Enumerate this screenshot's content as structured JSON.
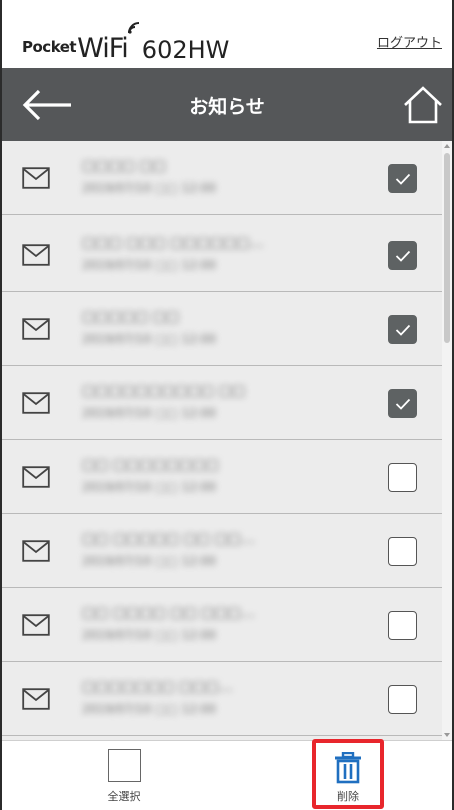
{
  "header": {
    "logo_pocket": "Pocket",
    "logo_wifi": "WiFi",
    "model": "602HW",
    "logout_label": "ログアウト"
  },
  "title_bar": {
    "title": "お知らせ",
    "back_icon": "arrow-left-icon",
    "home_icon": "home-icon"
  },
  "messages": [
    {
      "subject": "□□□□ □□",
      "date": "2019/07/10 □□ 12:00",
      "checked": true
    },
    {
      "subject": "□□□ □□□ □□□□□□…",
      "date": "2019/07/10 □□ 12:00",
      "checked": true
    },
    {
      "subject": "□□□□□ □□",
      "date": "2019/07/10 □□ 12:00",
      "checked": true
    },
    {
      "subject": "□□□□□□□□□□ □□",
      "date": "2019/07/10 □□ 12:00",
      "checked": true
    },
    {
      "subject": "□□ □□□□□□□□",
      "date": "2019/07/10 □□ 12:00",
      "checked": false
    },
    {
      "subject": "□□ □□□□□ □□ □□…",
      "date": "2019/07/10 □□ 12:00",
      "checked": false
    },
    {
      "subject": "□□ □□□□ □□ □□□…",
      "date": "2019/07/10 □□ 12:00",
      "checked": false
    },
    {
      "subject": "□□□□□□□ □□□…",
      "date": "2019/07/10 □□ 12:00",
      "checked": false
    }
  ],
  "toolbar": {
    "select_all_label": "全選択",
    "delete_label": "削除",
    "delete_icon": "trash-icon"
  },
  "colors": {
    "title_bar": "#555759",
    "list_bg": "#ececec",
    "checkbox_checked": "#5e6263",
    "delete_accent": "#1f6fc0",
    "highlight_border": "#e8262c"
  }
}
